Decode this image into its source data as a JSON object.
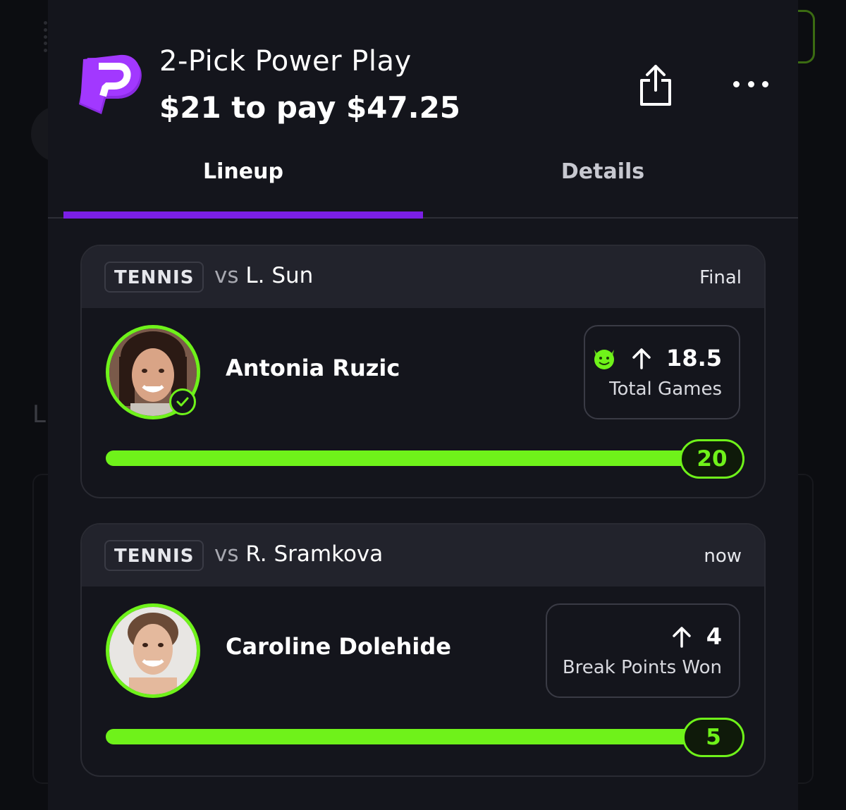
{
  "header": {
    "title": "2-Pick Power Play",
    "payout": "$21 to pay $47.25"
  },
  "tabs": [
    {
      "label": "Lineup",
      "active": true
    },
    {
      "label": "Details",
      "active": false
    }
  ],
  "picks": [
    {
      "sport": "TENNIS",
      "vs_prefix": "vs",
      "opponent": "L. Sun",
      "status": "Final",
      "player": "Antonia Ruzic",
      "direction_icon": "arrow-up-icon",
      "has_demon_icon": true,
      "line": "18.5",
      "stat": "Total Games",
      "result": "20",
      "progress": 1.0,
      "completed": true
    },
    {
      "sport": "TENNIS",
      "vs_prefix": "vs",
      "opponent": "R. Sramkova",
      "status": "now",
      "player": "Caroline Dolehide",
      "direction_icon": "arrow-up-icon",
      "has_demon_icon": false,
      "line": "4",
      "stat": "Break Points Won",
      "result": "5",
      "progress": 1.0,
      "completed": false
    }
  ],
  "colors": {
    "brand_purple": "#7b1fe6",
    "progress_green": "#6ff21a",
    "background": "#14151c"
  }
}
